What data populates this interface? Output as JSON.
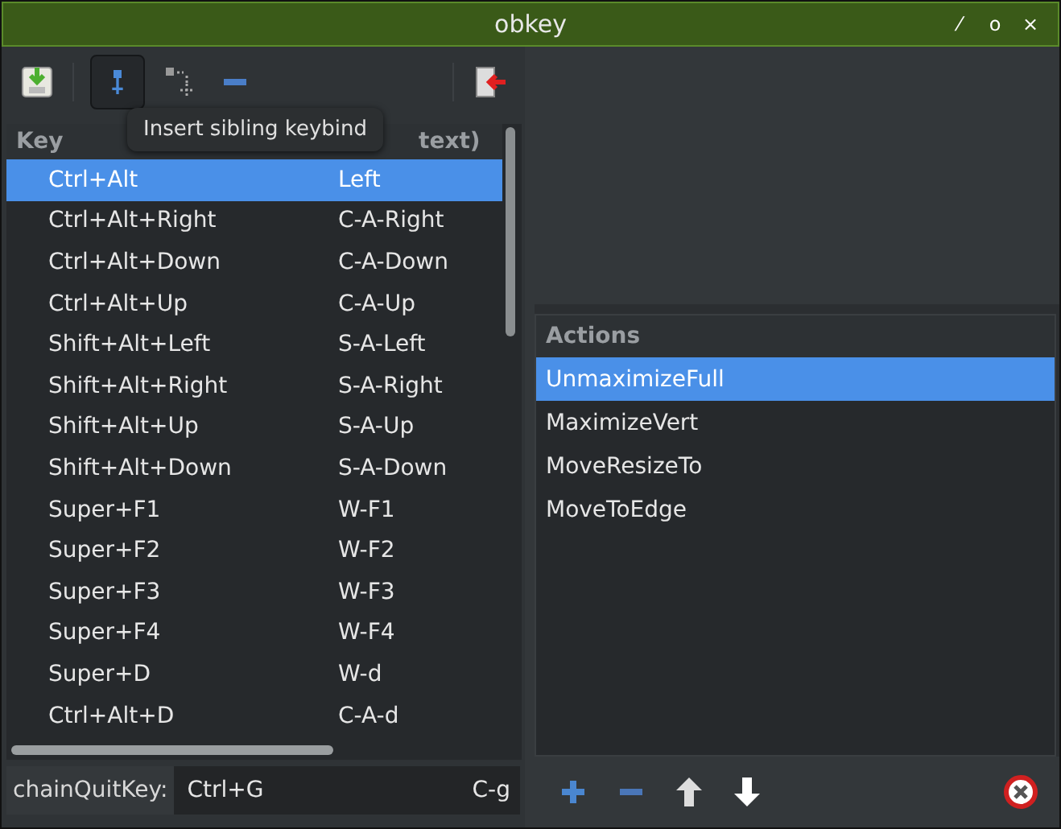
{
  "window": {
    "title": "obkey",
    "controls": [
      "⁄",
      "o",
      "×"
    ]
  },
  "tooltip": "Insert sibling keybind",
  "keybinds": {
    "columns": [
      "Key",
      "text)"
    ],
    "rows": [
      {
        "key": "Ctrl+Alt",
        "binding": "Left",
        "selected": true
      },
      {
        "key": "Ctrl+Alt+Right",
        "binding": "C-A-Right",
        "selected": false
      },
      {
        "key": "Ctrl+Alt+Down",
        "binding": "C-A-Down",
        "selected": false
      },
      {
        "key": "Ctrl+Alt+Up",
        "binding": "C-A-Up",
        "selected": false
      },
      {
        "key": "Shift+Alt+Left",
        "binding": "S-A-Left",
        "selected": false
      },
      {
        "key": "Shift+Alt+Right",
        "binding": "S-A-Right",
        "selected": false
      },
      {
        "key": "Shift+Alt+Up",
        "binding": "S-A-Up",
        "selected": false
      },
      {
        "key": "Shift+Alt+Down",
        "binding": "S-A-Down",
        "selected": false
      },
      {
        "key": "Super+F1",
        "binding": "W-F1",
        "selected": false
      },
      {
        "key": "Super+F2",
        "binding": "W-F2",
        "selected": false
      },
      {
        "key": "Super+F3",
        "binding": "W-F3",
        "selected": false
      },
      {
        "key": "Super+F4",
        "binding": "W-F4",
        "selected": false
      },
      {
        "key": "Super+D",
        "binding": "W-d",
        "selected": false
      },
      {
        "key": "Ctrl+Alt+D",
        "binding": "C-A-d",
        "selected": false
      }
    ]
  },
  "chain_quit_key": {
    "label": "chainQuitKey:",
    "value": "Ctrl+G",
    "binding": "C-g"
  },
  "actions": {
    "header": "Actions",
    "items": [
      {
        "label": "UnmaximizeFull",
        "selected": true
      },
      {
        "label": "MaximizeVert",
        "selected": false
      },
      {
        "label": "MoveResizeTo",
        "selected": false
      },
      {
        "label": "MoveToEdge",
        "selected": false
      }
    ]
  }
}
